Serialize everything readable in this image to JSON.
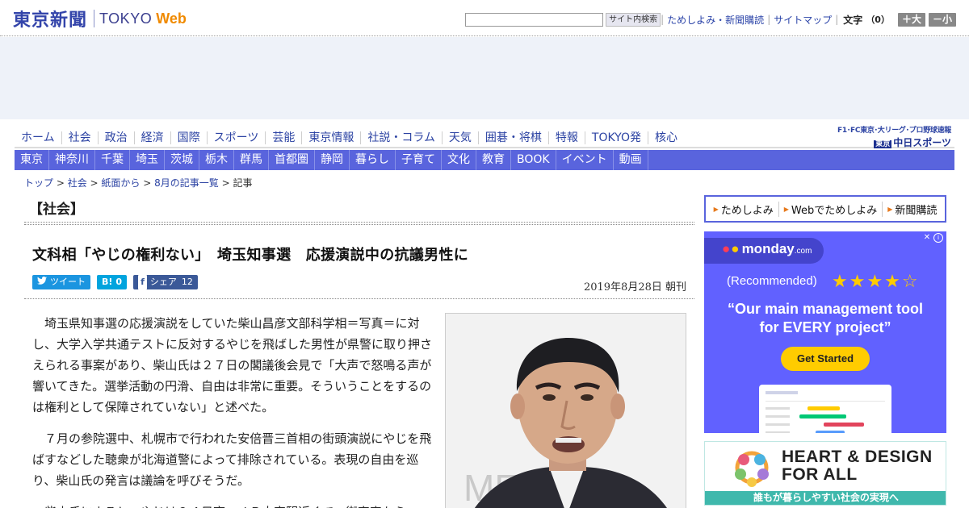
{
  "header": {
    "logo_jp": "東京新聞",
    "logo_en": "TOKYO",
    "logo_web": "Web",
    "search_placeholder": "",
    "search_button": "サイト内検索",
    "links": [
      "ためしよみ・新聞購読",
      "サイトマップ"
    ],
    "font_size_label": "文字",
    "font_size_value": "（0）",
    "font_plus": "＋大",
    "font_minus": "－小"
  },
  "main_nav": {
    "items": [
      "ホーム",
      "社会",
      "政治",
      "経済",
      "国際",
      "スポーツ",
      "芸能",
      "東京情報",
      "社説・コラム",
      "天気",
      "囲碁・将棋",
      "特報",
      "TOKYO発",
      "核心"
    ],
    "partner_top": "F1･FC東京･大リーグ･プロ野球速報",
    "partner_badge": "東京",
    "partner_name": "中日スポーツ"
  },
  "sub_nav": {
    "items": [
      "東京",
      "神奈川",
      "千葉",
      "埼玉",
      "茨城",
      "栃木",
      "群馬",
      "首都圏",
      "静岡",
      "暮らし",
      "子育て",
      "文化",
      "教育",
      "BOOK",
      "イベント",
      "動画"
    ]
  },
  "breadcrumb": {
    "items": [
      "トップ",
      "社会",
      "紙面から",
      "8月の記事一覧"
    ],
    "current": "記事",
    "sep": " > "
  },
  "article": {
    "section": "【社会】",
    "headline": "文科相「やじの権利ない」　埼玉知事選　応援演説中の抗議男性に",
    "share": {
      "tweet": "ツイート",
      "hatena_glyph": "B!",
      "hatena_count": "0",
      "fb_glyph": "f",
      "fb_label": "シェア",
      "fb_count": "12"
    },
    "date": "2019年8月28日 朝刊",
    "paragraphs": [
      "埼玉県知事選の応援演説をしていた柴山昌彦文部科学相＝写真＝に対し、大学入学共通テストに反対するやじを飛ばした男性が県警に取り押さえられる事案があり、柴山氏は２７日の閣議後会見で「大声で怒鳴る声が響いてきた。選挙活動の円滑、自由は非常に重要。そういうことをするのは権利として保障されていない」と述べた。",
      "７月の参院選中、札幌市で行われた安倍晋三首相の街頭演説にやじを飛ばすなどした聴衆が北海道警によって排除されている。表現の自由を巡り、柴山氏の発言は議論を呼びそうだ。",
      "柴山氏によると、やじは２４日夜、ＪＲ大宮駅近くで、街宣車から"
    ],
    "photo_text": "ME"
  },
  "sidebar": {
    "links": [
      "ためしよみ",
      "Webでためしよみ",
      "新聞購読"
    ],
    "ad1": {
      "brand": "monday",
      "brand_suffix": ".com",
      "recommended": "(Recommended)",
      "stars": "★★★★☆",
      "headline_1": "“Our main management tool",
      "headline_2": "for EVERY project”",
      "cta": "Get Started",
      "info": "i",
      "close": "✕"
    },
    "ad2": {
      "title_1": "HEART & DESIGN",
      "title_2": "FOR ALL",
      "bar": "誰もが暮らしやすい社会の実現へ"
    }
  }
}
